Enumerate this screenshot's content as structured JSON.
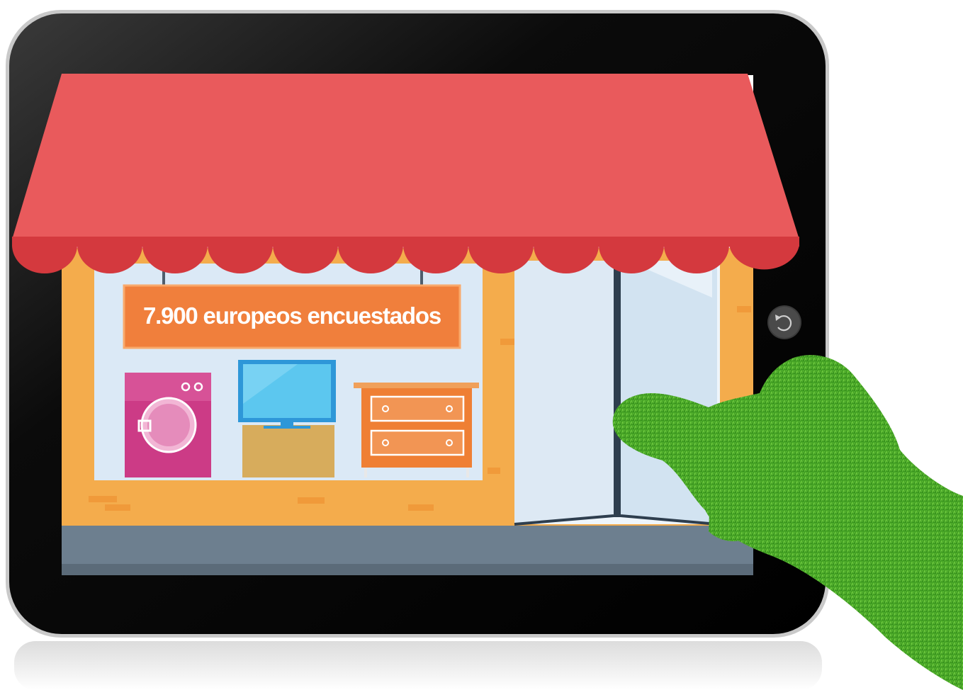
{
  "sign": {
    "text": "7.900 europeos encuestados"
  },
  "colors": {
    "awning": "#e95a5c",
    "awning_scallop": "#d4393e",
    "storefront": "#f4ac4c",
    "window_glass": "#dbe9f6",
    "sign_fill": "#f07f3c",
    "sidewalk": "#6d7f8f",
    "washing_machine": "#cc3b86",
    "tv_screen": "#5cc7ef",
    "tv_cabinet": "#d7ac5c",
    "dresser": "#ef7f34",
    "tablet_bezel": "#0d0d0d",
    "glove": "#4caf2c"
  },
  "icons": {
    "home_button": "refresh-circle-icon",
    "pointer": "green-grass-hand-icon"
  }
}
